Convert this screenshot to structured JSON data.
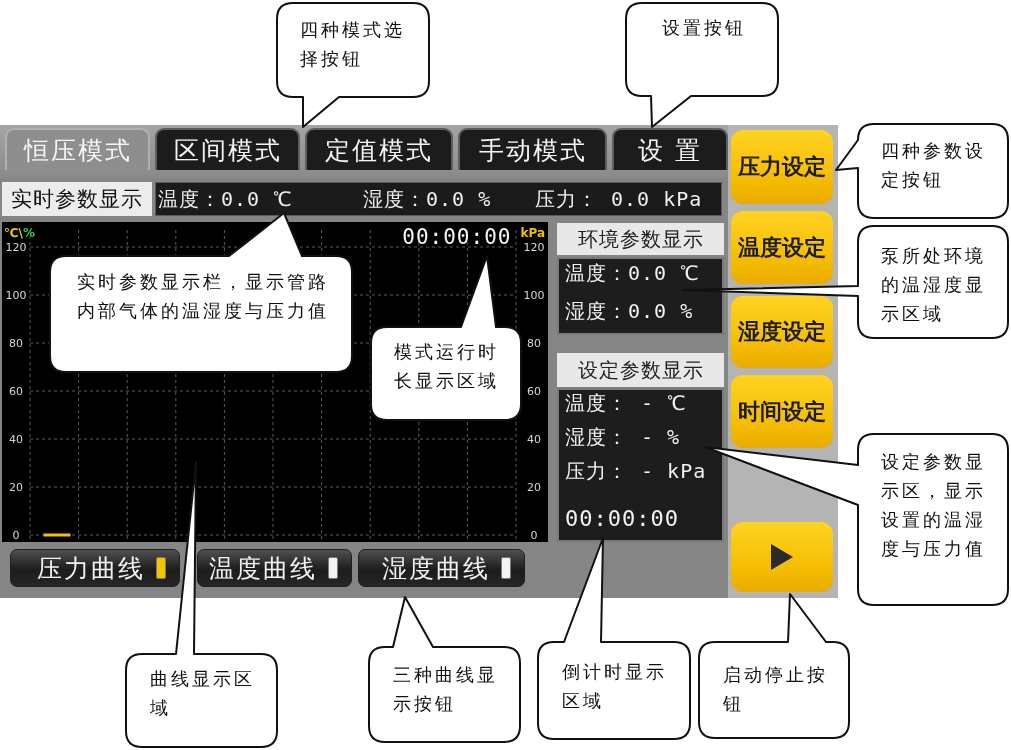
{
  "mode_tabs": [
    {
      "label": "恒压模式",
      "selected": true
    },
    {
      "label": "区间模式",
      "selected": false
    },
    {
      "label": "定值模式",
      "selected": false
    },
    {
      "label": "手动模式",
      "selected": false
    },
    {
      "label": "设 置",
      "selected": false
    }
  ],
  "realtime_bar": {
    "title": "实时参数显示",
    "readings": [
      "温度：0.0 ℃",
      "湿度：0.0 %",
      "压力： 0.0 kPa"
    ]
  },
  "chart": {
    "left_units": [
      {
        "text": "℃\\",
        "color": "#e8c800"
      },
      {
        "text": "%",
        "color": "#2ecc40"
      }
    ],
    "timer": "00:00:00",
    "right_unit": "kPa",
    "right_axis_labels": [
      "120",
      "100",
      "80",
      "60",
      "40",
      "20",
      "0"
    ],
    "chart_data": {
      "type": "line",
      "grid": true,
      "categories": [
        null,
        null,
        null,
        null,
        null,
        null,
        null,
        null,
        null,
        null,
        null,
        null,
        null,
        null,
        null,
        null,
        null,
        null
      ],
      "ylim": [
        0,
        120
      ],
      "yticks": [
        0,
        20,
        40,
        60,
        80,
        100,
        120
      ],
      "series": [
        {
          "color": "#f5c400",
          "values": [
            0,
            0,
            null,
            null,
            null,
            null,
            null,
            null,
            null,
            null,
            null,
            null,
            null,
            null,
            null,
            null,
            null,
            null
          ]
        }
      ]
    }
  },
  "curve_buttons": [
    {
      "label": "压力曲线",
      "on": true
    },
    {
      "label": "温度曲线",
      "on": false
    },
    {
      "label": "湿度曲线",
      "on": false
    }
  ],
  "environment_panel": {
    "title": "环境参数显示",
    "readings": [
      "温度：0.0 ℃",
      "湿度：0.0 %"
    ]
  },
  "setpoint_panel": {
    "title": "设定参数显示",
    "readings": [
      "温度： - ℃",
      "湿度： - %",
      "压力： - kPa"
    ],
    "countdown": "00:00:00"
  },
  "setting_buttons": [
    "压力设定",
    "温度设定",
    "湿度设定",
    "时间设定"
  ],
  "callouts": [
    "四种模式选择按钮",
    "设置按钮",
    "四种参数设定按钮",
    "实时参数显示栏，显示管路内部气体的温湿度与压力值",
    "模式运行时长显示区域",
    "泵所处环境的温湿度显示区域",
    "设定参数显示区，显示设置的温湿度与压力值",
    "曲线显示区域",
    "三种曲线显示按钮",
    "倒计时显示区域",
    "启动停止按钮"
  ]
}
